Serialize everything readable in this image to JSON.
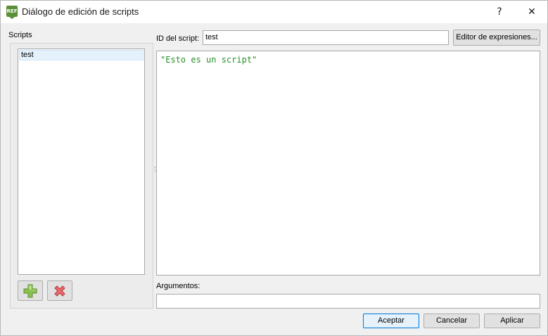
{
  "window": {
    "title": "Diálogo de edición de scripts",
    "icon_text": "REF",
    "help_glyph": "?",
    "close_glyph": "✕"
  },
  "scripts_panel": {
    "label": "Scripts",
    "items": [
      {
        "label": "test",
        "selected": true
      }
    ],
    "add_icon": "plus-icon",
    "remove_icon": "remove-x-icon"
  },
  "editor_panel": {
    "id_label": "ID del script:",
    "id_value": "test",
    "expression_editor_label": "Editor de expresiones...",
    "code": "\"Esto es un script\"",
    "code_color": "#2a8f2a",
    "arguments_label": "Argumentos:",
    "arguments_value": ""
  },
  "buttons": {
    "accept": "Aceptar",
    "cancel": "Cancelar",
    "apply": "Aplicar"
  },
  "colors": {
    "selection": "#e5f1fb",
    "default_button_border": "#0078d7",
    "add_green": "#7ab648",
    "remove_red": "#e0575b"
  }
}
